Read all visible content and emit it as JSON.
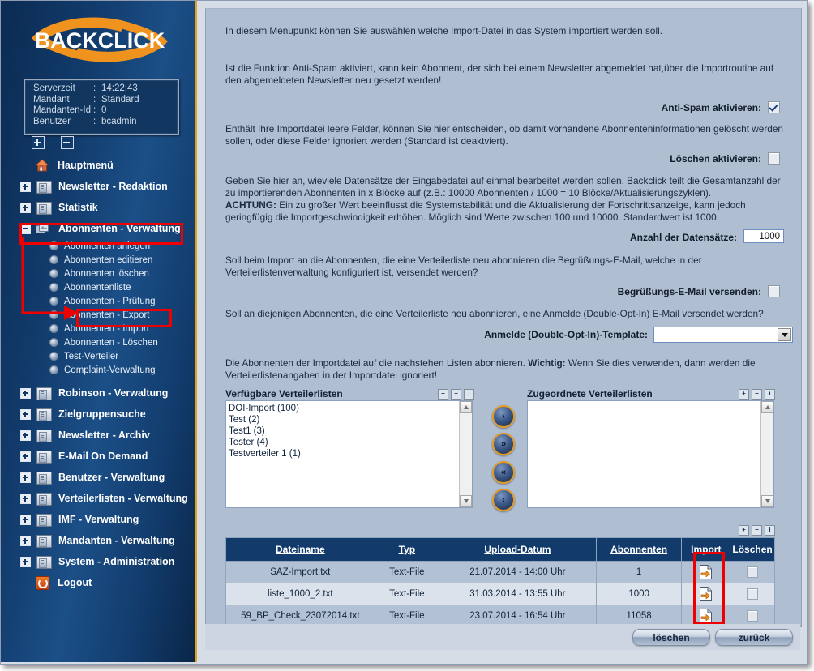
{
  "brand": {
    "name": "BACKCLICK"
  },
  "serverinfo": [
    {
      "key": "Serverzeit",
      "sep": ":",
      "value": "14:22:43"
    },
    {
      "key": "Mandant",
      "sep": ":",
      "value": "Standard"
    },
    {
      "key": "Mandanten-Id",
      "sep": ":",
      "value": "0"
    },
    {
      "key": "Benutzer",
      "sep": ":",
      "value": "bcadmin"
    }
  ],
  "tree_controls": {
    "expand_all": "+",
    "collapse_all": "-"
  },
  "sidebar": {
    "items": [
      {
        "label": "Hauptmenü",
        "icon": "house-icon",
        "expander": "none"
      },
      {
        "label": "Newsletter - Redaktion",
        "icon": "folder-icon",
        "expander": "plus"
      },
      {
        "label": "Statistik",
        "icon": "folder-icon",
        "expander": "plus"
      },
      {
        "label": "Abonnenten - Verwaltung",
        "icon": "cards-icon",
        "expander": "minus",
        "selected": true
      },
      {
        "label": "Robinson - Verwaltung",
        "icon": "folder-icon",
        "expander": "plus"
      },
      {
        "label": "Zielgruppensuche",
        "icon": "folder-icon",
        "expander": "plus"
      },
      {
        "label": "Newsletter - Archiv",
        "icon": "folder-icon",
        "expander": "plus"
      },
      {
        "label": "E-Mail On Demand",
        "icon": "folder-icon",
        "expander": "plus"
      },
      {
        "label": "Benutzer - Verwaltung",
        "icon": "folder-icon",
        "expander": "plus"
      },
      {
        "label": "Verteilerlisten - Verwaltung",
        "icon": "folder-icon",
        "expander": "plus"
      },
      {
        "label": "IMF - Verwaltung",
        "icon": "folder-icon",
        "expander": "plus"
      },
      {
        "label": "Mandanten - Verwaltung",
        "icon": "folder-icon",
        "expander": "plus"
      },
      {
        "label": "System - Administration",
        "icon": "folder-icon",
        "expander": "plus"
      },
      {
        "label": "Logout",
        "icon": "logout-icon",
        "expander": "none"
      }
    ],
    "subitems": [
      {
        "label": "Abonnenten anlegen"
      },
      {
        "label": "Abonnenten editieren"
      },
      {
        "label": "Abonnenten löschen"
      },
      {
        "label": "Abonnentenliste"
      },
      {
        "label": "Abonnenten - Prüfung"
      },
      {
        "label": "Abonnenten - Export"
      },
      {
        "label": "Abonnenten - Import",
        "highlighted": true
      },
      {
        "label": "Abonnenten - Löschen"
      },
      {
        "label": "Test-Verteiler"
      },
      {
        "label": "Complaint-Verwaltung"
      }
    ]
  },
  "main": {
    "intro": "In diesem Menupunkt können Sie auswählen welche Import-Datei in das System importiert werden soll.",
    "antispam_text": "Ist die Funktion Anti-Spam aktiviert, kann kein Abonnent, der sich bei einem Newsletter abgemeldet hat,über die Importroutine auf den abgemeldeten Newsletter neu gesetzt werden!",
    "antispam_label": "Anti-Spam aktivieren:",
    "loeschen_text": "Enthält Ihre Importdatei leere Felder, können Sie hier entscheiden, ob damit vorhandene Abonnenteninformationen gelöscht werden sollen, oder diese Felder ignoriert werden (Standard ist deaktviert).",
    "loeschen_label": "Löschen aktivieren:",
    "datensaetze_text_1": "Geben Sie hier an, wieviele Datensätze der Eingabedatei auf einmal bearbeitet werden sollen. Backclick teilt die Gesamtanzahl der zu importierenden Abonnenten in x Blöcke auf (z.B.: 10000 Abonnenten / 1000 = 10 Blöcke/Aktualisierungszyklen).",
    "datensaetze_warn_label": "ACHTUNG:",
    "datensaetze_text_2": " Ein zu großer Wert beeinflusst die Systemstabilität und die Aktualisierung der Fortschrittsanzeige, kann jedoch geringfügig die Importgeschwindigkeit erhöhen. Möglich sind Werte zwischen 100 und 10000. Standardwert ist 1000.",
    "datensaetze_label": "Anzahl der Datensätze:",
    "datensaetze_value": "1000",
    "begruessung_text": "Soll beim Import an die Abonnenten, die eine Verteilerliste neu abonnieren die Begrüßungs-E-Mail, welche in der Verteilerlistenverwaltung konfiguriert ist, versendet werden?",
    "begruessung_label": "Begrüßungs-E-Mail versenden:",
    "doi_text": "Soll an diejenigen Abonnenten, die eine Verteilerliste neu abonnieren, eine Anmelde (Double-Opt-In) E-Mail versendet werden?",
    "doi_label": "Anmelde (Double-Opt-In)-Template:",
    "doi_value": "",
    "listen_text_1": "Die Abonnenten der Importdatei auf die nachstehen Listen abonnieren. ",
    "listen_wichtig": "Wichtig:",
    "listen_text_2": " Wenn Sie dies verwenden, dann werden die Verteilerlistenangaben in der Importdatei ignoriert!"
  },
  "lists": {
    "available_title": "Verfügbare Verteilerlisten",
    "assigned_title": "Zugeordnete Verteilerlisten",
    "available_options": [
      "DOI-Import (100)",
      "Test (2)",
      "Test1 (3)",
      "Tester (4)",
      "Testverteiler 1 (1)"
    ],
    "assigned_options": [],
    "move_buttons": [
      {
        "glyph": "›",
        "name": "move-right-button"
      },
      {
        "glyph": "»",
        "name": "move-all-right-button"
      },
      {
        "glyph": "«",
        "name": "move-all-left-button"
      },
      {
        "glyph": "‹",
        "name": "move-left-button"
      }
    ],
    "panel_tools": [
      {
        "glyph": "+",
        "name": "expand-icon"
      },
      {
        "glyph": "−",
        "name": "collapse-icon"
      },
      {
        "glyph": "i",
        "name": "info-icon"
      }
    ]
  },
  "table": {
    "columns": [
      "Dateiname",
      "Typ",
      "Upload-Datum",
      "Abonnenten",
      "Import",
      "Löschen"
    ],
    "rows": [
      {
        "dateiname": "SAZ-Import.txt",
        "typ": "Text-File",
        "upload": "21.07.2014 - 14:00 Uhr",
        "abonnenten": "1"
      },
      {
        "dateiname": "liste_1000_2.txt",
        "typ": "Text-File",
        "upload": "31.03.2014 - 13:55 Uhr",
        "abonnenten": "1000"
      },
      {
        "dateiname": "59_BP_Check_23072014.txt",
        "typ": "Text-File",
        "upload": "23.07.2014 - 16:54 Uhr",
        "abonnenten": "11058"
      }
    ]
  },
  "footer": {
    "delete_label": "löschen",
    "back_label": "zurück"
  },
  "colors": {
    "sidebar_dark": "#0b2b52",
    "accent_orange": "#e59a22",
    "panel_bg": "#b0bed2",
    "table_header": "#123a6b",
    "annotation_red": "#ee0000"
  }
}
